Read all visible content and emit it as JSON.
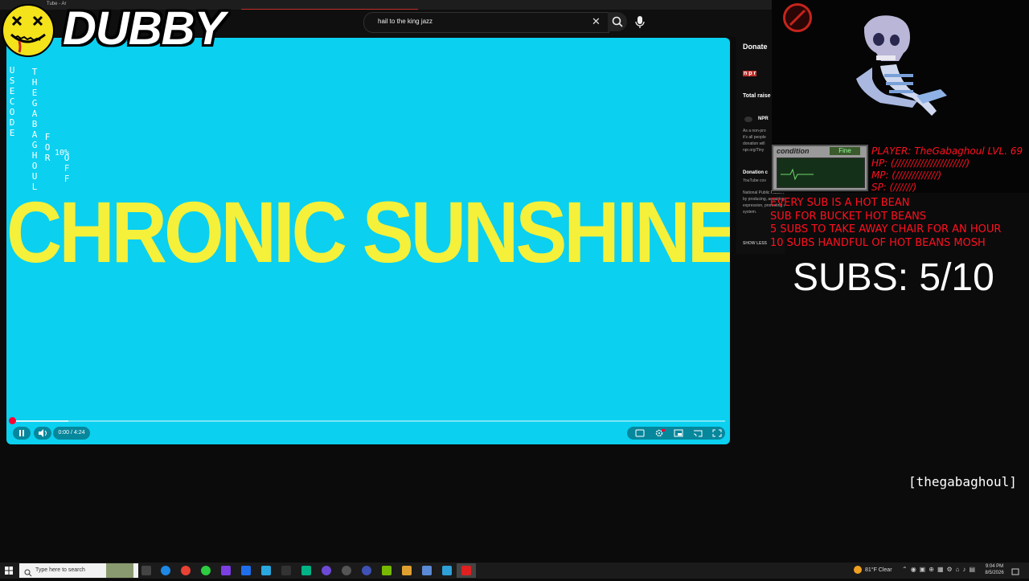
{
  "browser": {
    "tab_title": "Tube - Ar",
    "search_query": "hail to the king jazz"
  },
  "overlay": {
    "logo_text": "DUBBY",
    "promo_columns": [
      [
        "U",
        "S",
        "E",
        " ",
        "C",
        "O",
        "D",
        "E"
      ],
      [
        "T",
        "H",
        "E",
        "G",
        "A",
        "B",
        "A",
        "G",
        "H",
        "O",
        "U",
        "L"
      ],
      [
        "F",
        "O",
        "R"
      ],
      [
        "O",
        "F",
        "F"
      ],
      [
        "10%"
      ]
    ],
    "condition_label": "condition",
    "condition_status": "Fine",
    "stats": {
      "player": "PLAYER: TheGabaghoul LVL. 69",
      "hp": "HP:    (//////////////////////)",
      "mp": "MP:    (/////////////)",
      "sp": "SP:   (//////)"
    },
    "goals": [
      "EVERY SUB IS A HOT BEAN",
      "SUB FOR BUCKET HOT BEANS",
      "5 SUBS TO TAKE AWAY CHAIR FOR AN HOUR",
      "10 SUBS HANDFUL OF HOT BEANS MOSH"
    ],
    "subs_counter": "SUBS: 5/10",
    "username": "[thegabaghoul]"
  },
  "video": {
    "title_text": "CHRONIC SUNSHINE",
    "time": "0:00 / 4:24",
    "progress_fraction": 0.0,
    "buffer_fraction": 0.08,
    "background_color": "#0bd0f0",
    "title_color": "#f5f03a"
  },
  "donate_panel": {
    "header": "Donate",
    "org_logo": "n p r",
    "total_raised": "Total raise",
    "org_name": "NPR",
    "desc_lines": [
      "As a non-pro",
      "it's all people",
      "donation will",
      "npr.org/Tiny"
    ],
    "donation_label": "Donation c",
    "donation_sub": "YouTube cov",
    "body_text": "National Public Radio. A member public radio station licensees ( Member stations ) to create a more informed public  NPR accomplishes its mission by producing, acquiring and distributing noncommercial programming that meets the highest standards of public service in journalism and cultural expression, promoting understanding and appreciation of events, ideas and cultures. Providing satellite interconnection for the entire public radio system.",
    "show_less": "SHOW LESS"
  },
  "taskbar": {
    "search_placeholder": "Type here to search",
    "weather": "81°F  Clear",
    "time": "9:04 PM",
    "date": "8/5/2026"
  },
  "colors": {
    "accent_red": "#ff0033",
    "overlay_red": "#ff1020",
    "logo_yellow": "#f4e21a"
  }
}
